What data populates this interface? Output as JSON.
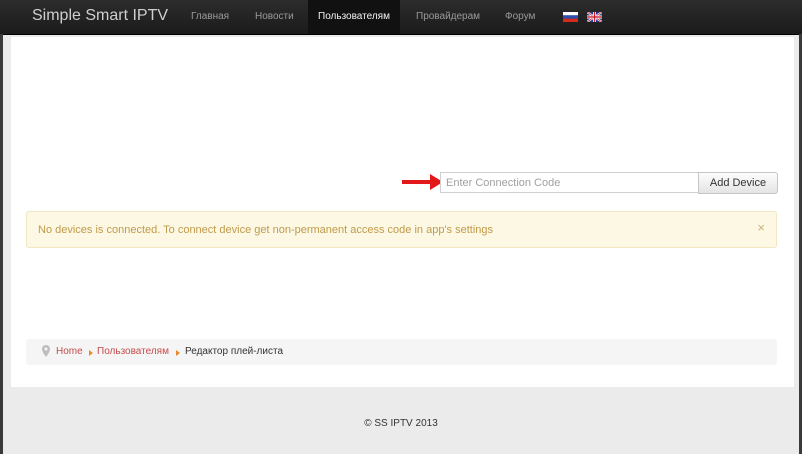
{
  "navbar": {
    "brand": "Simple Smart IPTV",
    "items": [
      {
        "label": "Главная",
        "active": false
      },
      {
        "label": "Новости",
        "active": false
      },
      {
        "label": "Пользователям",
        "active": true
      },
      {
        "label": "Провайдерам",
        "active": false
      },
      {
        "label": "Форум",
        "active": false
      }
    ],
    "flags": [
      "russian-flag-icon",
      "english-flag-icon"
    ]
  },
  "device": {
    "input_value": "",
    "input_placeholder": "Enter Connection Code",
    "add_label": "Add Device"
  },
  "alert": {
    "text": "No devices is connected. To connect device get non-permanent access code in app's settings",
    "close": "×"
  },
  "breadcrumb": {
    "items": [
      "Home",
      "Пользователям",
      "Редактор плей-листа"
    ]
  },
  "footer": {
    "text": "© SS IPTV 2013"
  },
  "colors": {
    "navbar": "#1b1b1b",
    "alert_bg": "#fcf8e3",
    "alert_text": "#c19a4c",
    "link": "#c64b4b",
    "annotation_arrow": "#e31818"
  }
}
